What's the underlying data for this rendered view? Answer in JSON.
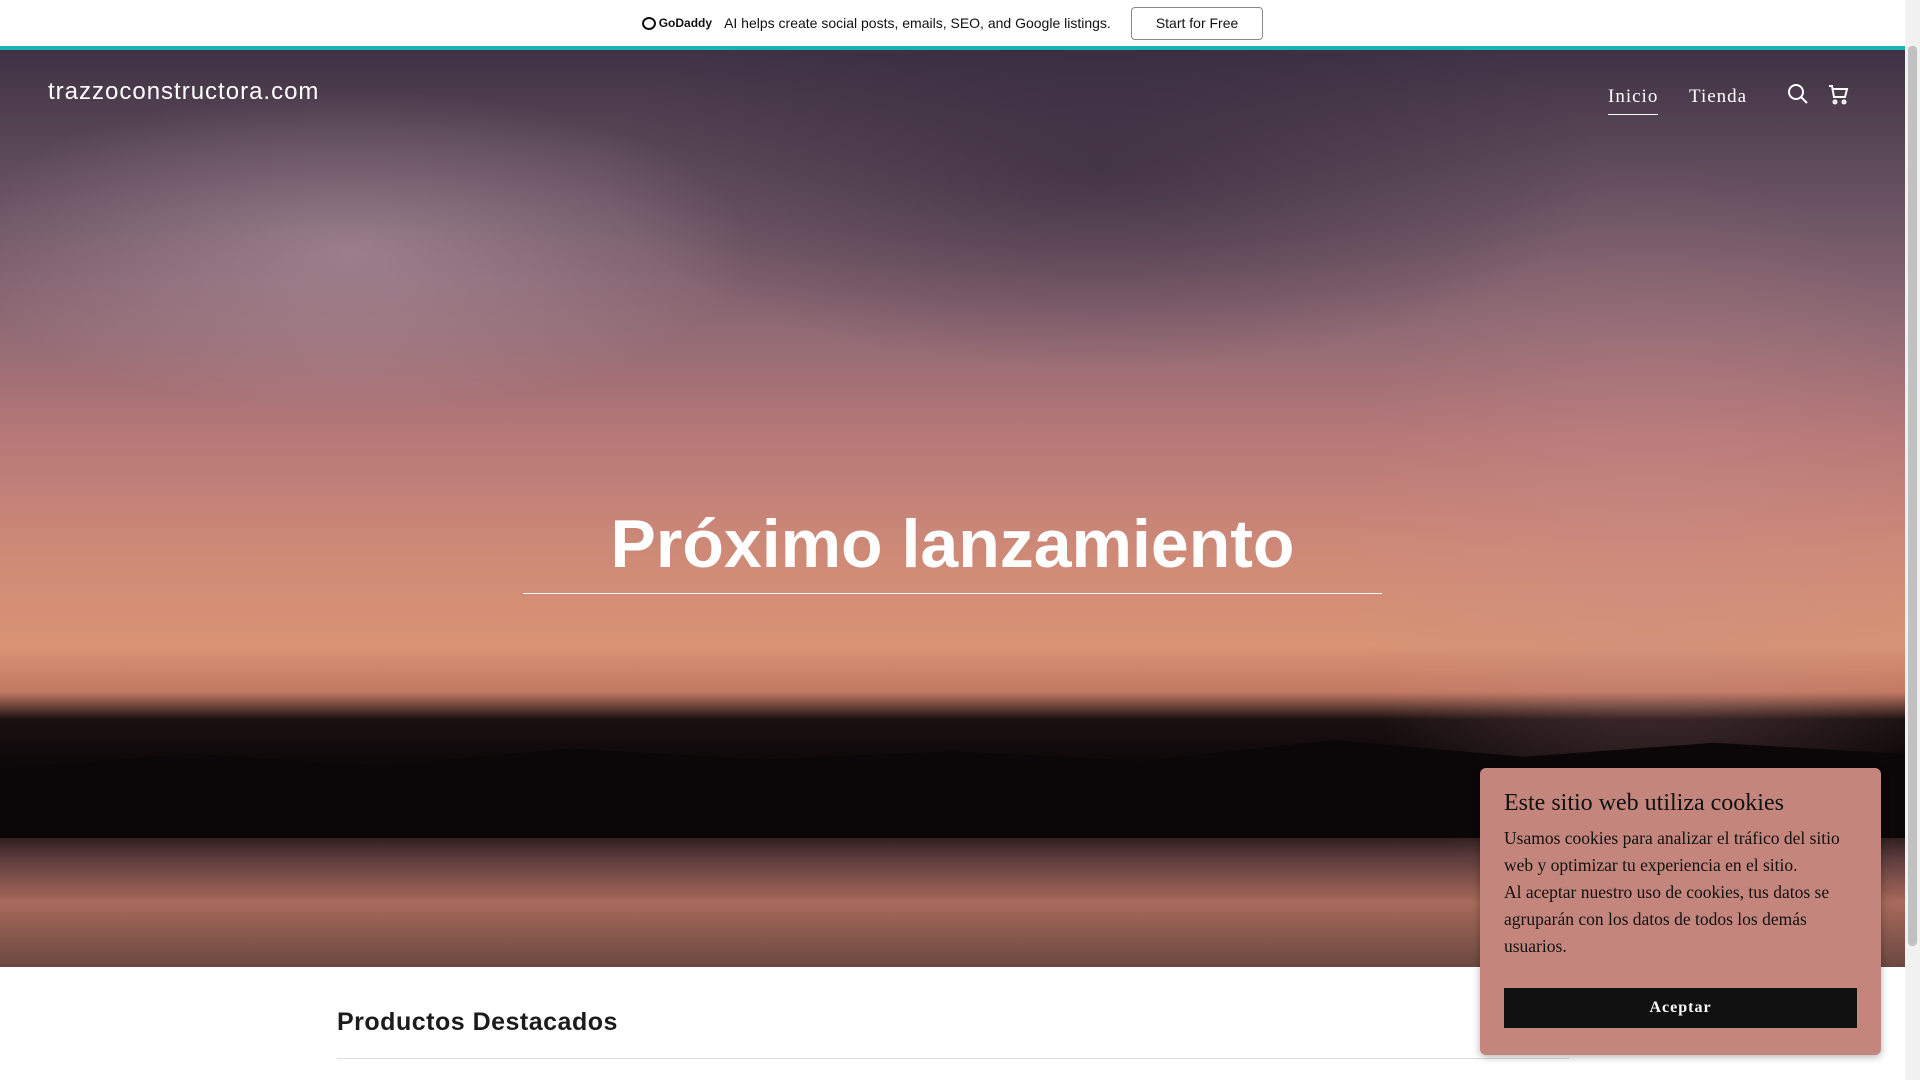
{
  "banner": {
    "brand": "GoDaddy",
    "message": "AI helps create social posts, emails, SEO, and Google listings.",
    "cta": "Start for Free"
  },
  "header": {
    "site_name": "trazzoconstructora.com",
    "nav": [
      {
        "label": "Inicio",
        "active": true
      },
      {
        "label": "Tienda",
        "active": false
      }
    ],
    "icons": [
      "search-icon",
      "cart-icon"
    ]
  },
  "hero": {
    "title": "Próximo lanzamiento"
  },
  "products": {
    "title": "Productos Destacados"
  },
  "cookie": {
    "title": "Este sitio web utiliza cookies",
    "paragraph1": "Usamos cookies para analizar el tráfico del sitio web y optimizar tu experiencia en el sitio.",
    "paragraph2": "Al aceptar nuestro uso de cookies, tus datos se agruparán con los datos de todos los demás usuarios.",
    "accept": "Aceptar"
  },
  "colors": {
    "accent": "#1bb2b3",
    "cookie_bg": "#c4867c"
  }
}
